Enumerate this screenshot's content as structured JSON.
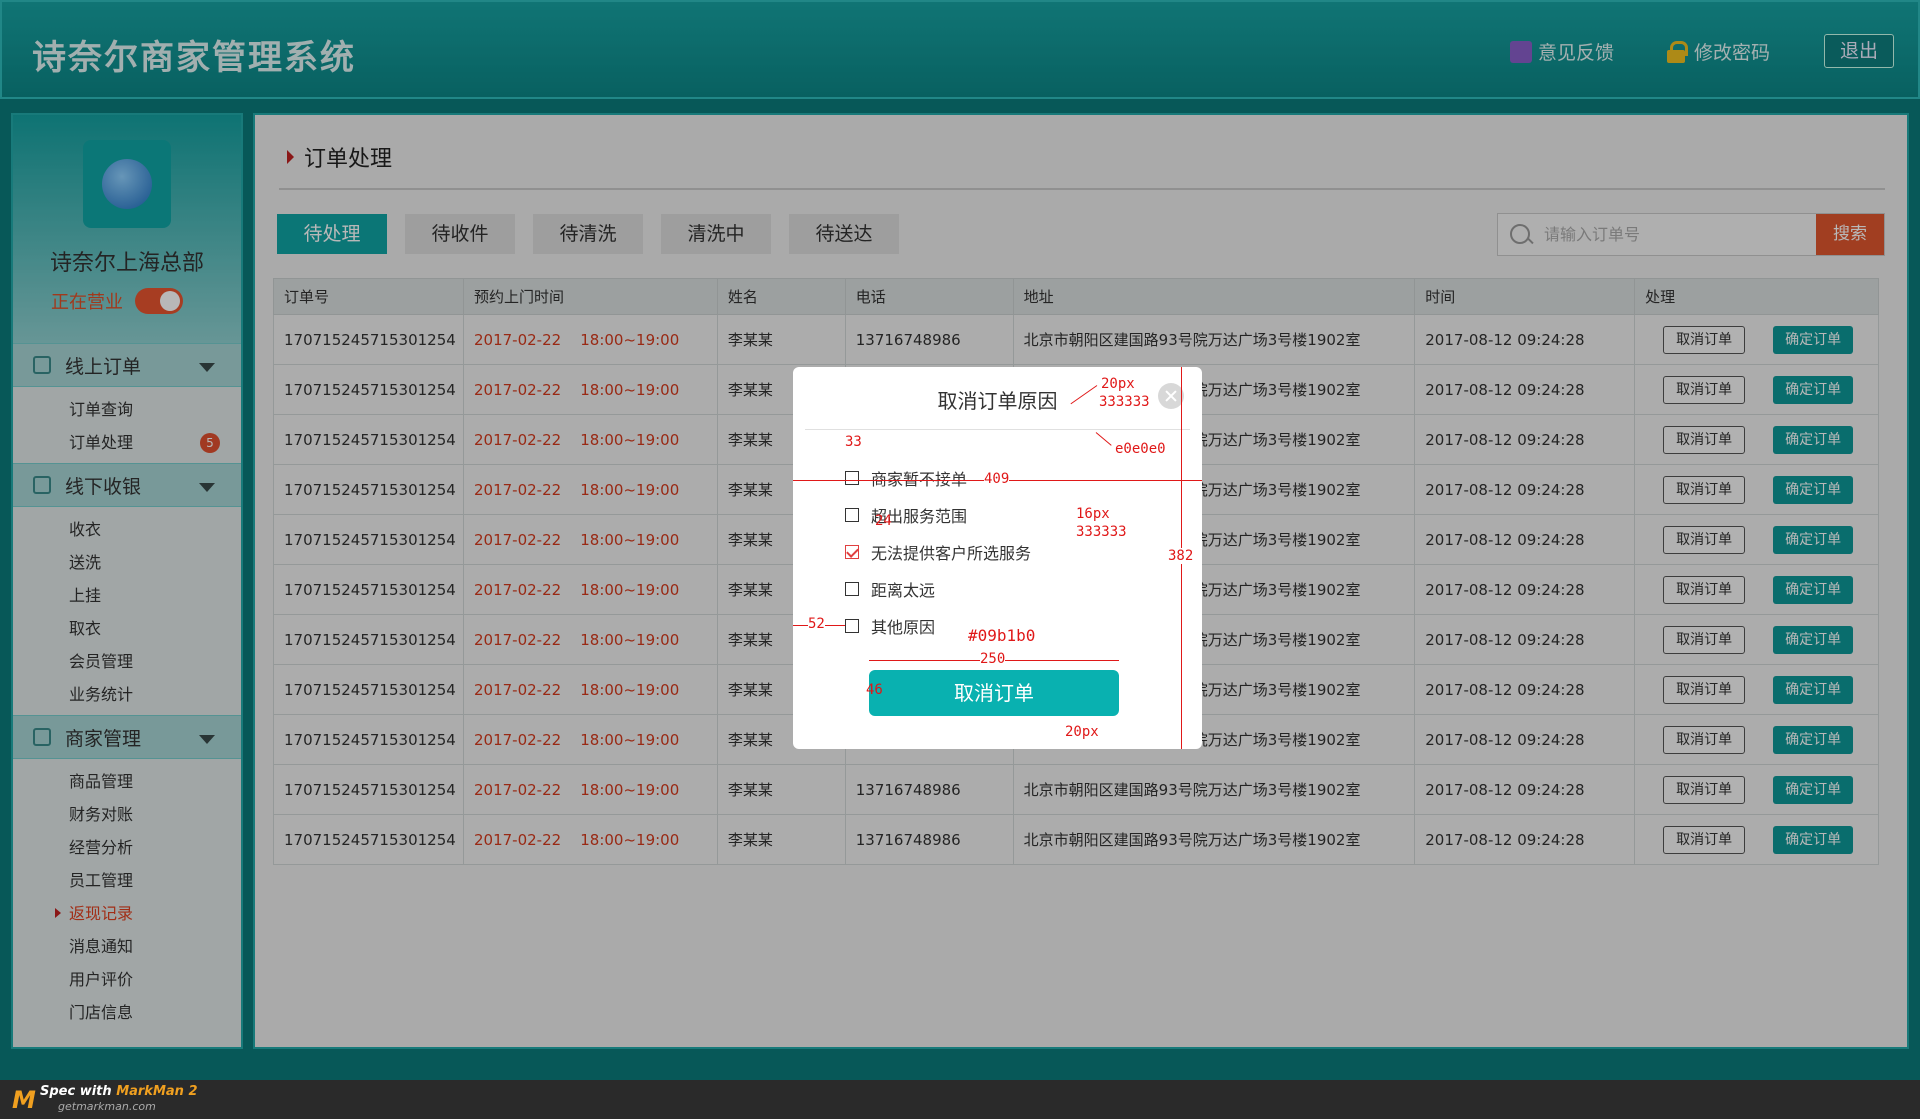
{
  "app": {
    "title": "诗奈尔商家管理系统"
  },
  "header": {
    "feedback": "意见反馈",
    "change_password": "修改密码",
    "logout": "退出"
  },
  "sidebar": {
    "store_name": "诗奈尔上海总部",
    "status_label": "正在营业",
    "sections": [
      {
        "title": "线上订单",
        "items": [
          {
            "label": "订单查询"
          },
          {
            "label": "订单处理",
            "badge": "5"
          }
        ]
      },
      {
        "title": "线下收银",
        "items": [
          {
            "label": "收衣"
          },
          {
            "label": "送洗"
          },
          {
            "label": "上挂"
          },
          {
            "label": "取衣"
          },
          {
            "label": "会员管理"
          },
          {
            "label": "业务统计"
          }
        ]
      },
      {
        "title": "商家管理",
        "items": [
          {
            "label": "商品管理"
          },
          {
            "label": "财务对账"
          },
          {
            "label": "经营分析"
          },
          {
            "label": "员工管理"
          },
          {
            "label": "返现记录",
            "active": true
          },
          {
            "label": "消息通知"
          },
          {
            "label": "用户评价"
          },
          {
            "label": "门店信息"
          }
        ]
      }
    ]
  },
  "main": {
    "title": "订单处理",
    "tabs": [
      "待处理",
      "待收件",
      "待清洗",
      "清洗中",
      "待送达"
    ],
    "search": {
      "placeholder": "请输入订单号",
      "button": "搜索"
    },
    "columns": [
      "订单号",
      "预约上门时间",
      "姓名",
      "电话",
      "地址",
      "时间",
      "处理"
    ],
    "row": {
      "order_no": "170715245715301254",
      "date": "2017-02-22",
      "slot": "18:00~19:00",
      "name": "李某某",
      "phone": "13716748986",
      "address": "北京市朝阳区建国路93号院万达广场3号楼1902室",
      "time": "2017-08-12  09:24:28"
    },
    "row_count": 11,
    "cancel_label": "取消订单",
    "confirm_label": "确定订单"
  },
  "modal": {
    "title": "取消订单原因",
    "reasons": [
      {
        "label": "商家暂不接单",
        "checked": false
      },
      {
        "label": "超出服务范围",
        "checked": false
      },
      {
        "label": "无法提供客户所选服务",
        "checked": true
      },
      {
        "label": "距离太远",
        "checked": false
      },
      {
        "label": "其他原因",
        "checked": false
      }
    ],
    "button": "取消订单"
  },
  "annotations": {
    "title_size": "20px",
    "title_color": "333333",
    "line_color": "e0e0e0",
    "gap_top": "33",
    "width": "409",
    "row_height": "24",
    "text_size": "16px",
    "text_color": "333333",
    "height": "382",
    "left_pad": "52",
    "btn_color": "#09b1b0",
    "btn_width": "250",
    "btn_height": "46",
    "btn_text_size": "20px"
  },
  "footer": {
    "spec_prefix": "Spec with ",
    "spec_brand": "MarkMan 2",
    "spec_url": "getmarkman.com"
  }
}
